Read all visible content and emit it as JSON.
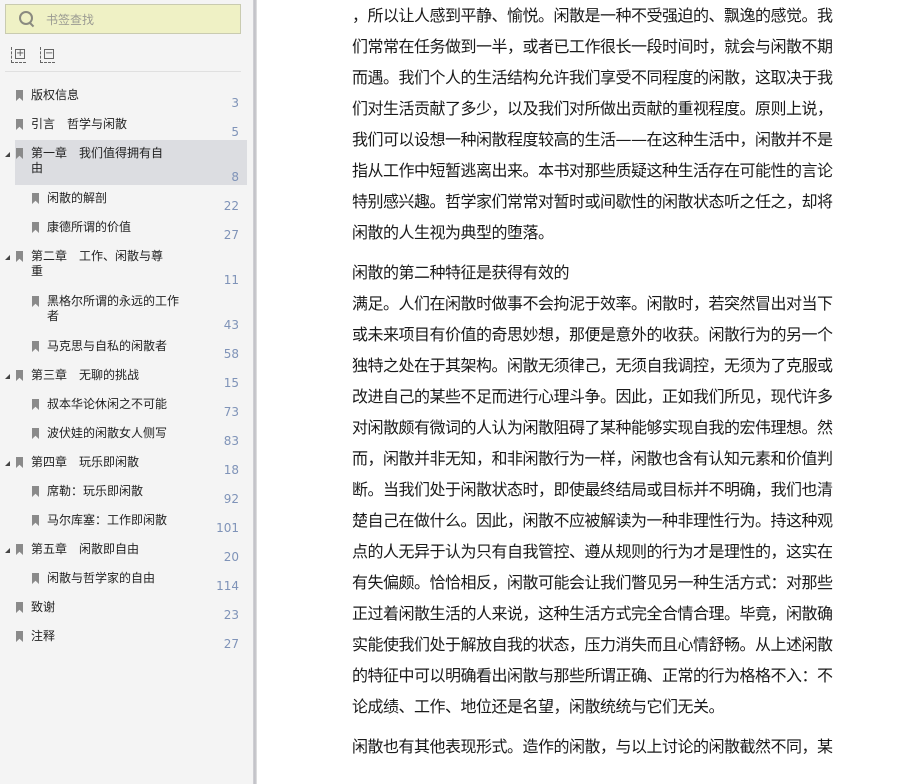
{
  "sidebar": {
    "search_placeholder": "书签查找",
    "tools": {
      "expand_all": "+",
      "collapse_all": "−"
    },
    "items": [
      {
        "label": "版权信息",
        "page": "3",
        "level": 1
      },
      {
        "label": "引言　哲学与闲散",
        "page": "5",
        "level": 1
      },
      {
        "label": "第一章　我们值得拥有自由",
        "page": "8",
        "level": 1,
        "expanded": true,
        "selected": true
      },
      {
        "label": "闲散的解剖",
        "page": "22",
        "level": 2
      },
      {
        "label": "康德所谓的价值",
        "page": "27",
        "level": 2
      },
      {
        "label": "第二章　工作、闲散与尊重",
        "page": "11",
        "level": 1,
        "expanded": true
      },
      {
        "label": "黑格尔所谓的永远的工作者",
        "page": "43",
        "level": 2
      },
      {
        "label": "马克思与自私的闲散者",
        "page": "58",
        "level": 2
      },
      {
        "label": "第三章　无聊的挑战",
        "page": "15",
        "level": 1,
        "expanded": true
      },
      {
        "label": "叔本华论休闲之不可能",
        "page": "73",
        "level": 2
      },
      {
        "label": "波伏娃的闲散女人侧写",
        "page": "83",
        "level": 2
      },
      {
        "label": "第四章　玩乐即闲散",
        "page": "18",
        "level": 1,
        "expanded": true
      },
      {
        "label": "席勒：玩乐即闲散",
        "page": "92",
        "level": 2
      },
      {
        "label": "马尔库塞：工作即闲散",
        "page": "101",
        "level": 2
      },
      {
        "label": "第五章　闲散即自由",
        "page": "20",
        "level": 1,
        "expanded": true
      },
      {
        "label": "闲散与哲学家的自由",
        "page": "114",
        "level": 2
      },
      {
        "label": "致谢",
        "page": "23",
        "level": 1
      },
      {
        "label": "注释",
        "page": "27",
        "level": 1
      }
    ]
  },
  "content": {
    "paragraphs": [
      [
        "，所以让人感到平静、愉悦。闲散是一种不受强迫的、飘逸的感觉。我",
        "们常常在任务做到一半，或者已工作很长一段时间时，就会与闲散不期",
        "而遇。我们个人的生活结构允许我们享受不同程度的闲散，这取决于我",
        "们对生活贡献了多少，以及我们对所做出贡献的重视程度。原则上说，",
        "我们可以设想一种闲散程度较高的生活——在这种生活中，闲散并不是",
        "指从工作中短暂逃离出来。本书对那些质疑这种生活存在可能性的言论",
        "特别感兴趣。哲学家们常常对暂时或间歇性的闲散状态听之任之，却将",
        "闲散的人生视为典型的堕落。"
      ],
      [
        "闲散的第二种特征是获得有效的",
        "满足。人们在闲散时做事不会拘泥于效率。闲散时，若突然冒出对当下",
        "或未来项目有价值的奇思妙想，那便是意外的收获。闲散行为的另一个",
        "独特之处在于其架构。闲散无须律己，无须自我调控，无须为了克服或",
        "改进自己的某些不足而进行心理斗争。因此，正如我们所见，现代许多",
        "对闲散颇有微词的人认为闲散阻碍了某种能够实现自我的宏伟理想。然",
        "而，闲散并非无知，和非闲散行为一样，闲散也含有认知元素和价值判",
        "断。当我们处于闲散状态时，即使最终结局或目标并不明确，我们也清",
        "楚自己在做什么。因此，闲散不应被解读为一种非理性行为。持这种观",
        "点的人无异于认为只有自我管控、遵从规则的行为才是理性的，这实在",
        "有失偏颇。恰恰相反，闲散可能会让我们瞥见另一种生活方式：对那些",
        "正过着闲散生活的人来说，这种生活方式完全合情合理。毕竟，闲散确",
        "实能使我们处于解放自我的状态，压力消失而且心情舒畅。从上述闲散",
        "的特征中可以明确看出闲散与那些所谓正确、正常的行为格格不入：不",
        "论成绩、工作、地位还是名望，闲散统统与它们无关。"
      ],
      [
        "闲散也有其他表现形式。造作的闲散，与以上讨论的闲散截然不同，某"
      ]
    ]
  }
}
